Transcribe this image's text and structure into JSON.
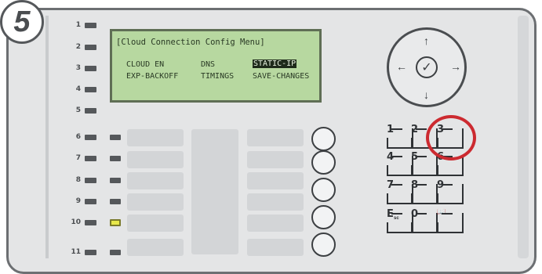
{
  "step_number": "5",
  "zones": [
    "1",
    "2",
    "3",
    "4",
    "5",
    "6",
    "7",
    "8",
    "9",
    "10",
    "11"
  ],
  "lcd": {
    "title": "[Cloud Connection Config Menu]",
    "items": [
      {
        "label": "CLOUD EN",
        "selected": false
      },
      {
        "label": "DNS",
        "selected": false
      },
      {
        "label": "STATIC-IP",
        "selected": true
      },
      {
        "label": "EXP-BACKOFF",
        "selected": false
      },
      {
        "label": "TIMINGS",
        "selected": false
      },
      {
        "label": "SAVE-CHANGES",
        "selected": false
      }
    ]
  },
  "nav": {
    "up": "↑",
    "down": "↓",
    "left": "←",
    "right": "→",
    "ok": "✓"
  },
  "keypad": [
    {
      "label": "1",
      "sub": ""
    },
    {
      "label": "2",
      "sub": ""
    },
    {
      "label": "3",
      "sub": ""
    },
    {
      "label": "4",
      "sub": ""
    },
    {
      "label": "5",
      "sub": ""
    },
    {
      "label": "6",
      "sub": ""
    },
    {
      "label": "7",
      "sub": ""
    },
    {
      "label": "8",
      "sub": ""
    },
    {
      "label": "9",
      "sub": ""
    },
    {
      "label": "E",
      "sub": "sc"
    },
    {
      "label": "0",
      "sub": ""
    },
    {
      "label": "📖",
      "sub": ""
    }
  ],
  "highlighted_key": "3",
  "colors": {
    "lcd_bg": "#b7d8a0",
    "highlight": "#cc2a30",
    "lit_led": "#e8e84a"
  }
}
